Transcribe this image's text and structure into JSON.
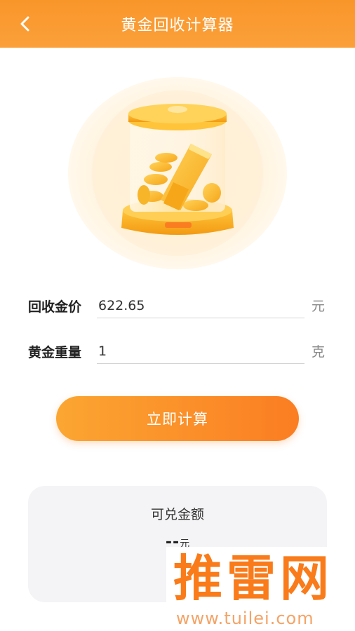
{
  "header": {
    "title": "黄金回收计算器",
    "back_icon": "chevron-left-icon"
  },
  "form": {
    "price_label": "回收金价",
    "price_value": "622.65",
    "price_unit": "元",
    "weight_label": "黄金重量",
    "weight_value": "1",
    "weight_unit": "克"
  },
  "calculate_button": "立即计算",
  "result": {
    "title": "可兑金额",
    "amount": "--",
    "unit": "元"
  },
  "watermark": {
    "brand": "推雷网",
    "url": "www.tuilei.com"
  },
  "colors": {
    "accent": "#fb8f2a",
    "button_start": "#fba632",
    "button_end": "#fb7d22",
    "card_bg": "#f4f4f6"
  }
}
